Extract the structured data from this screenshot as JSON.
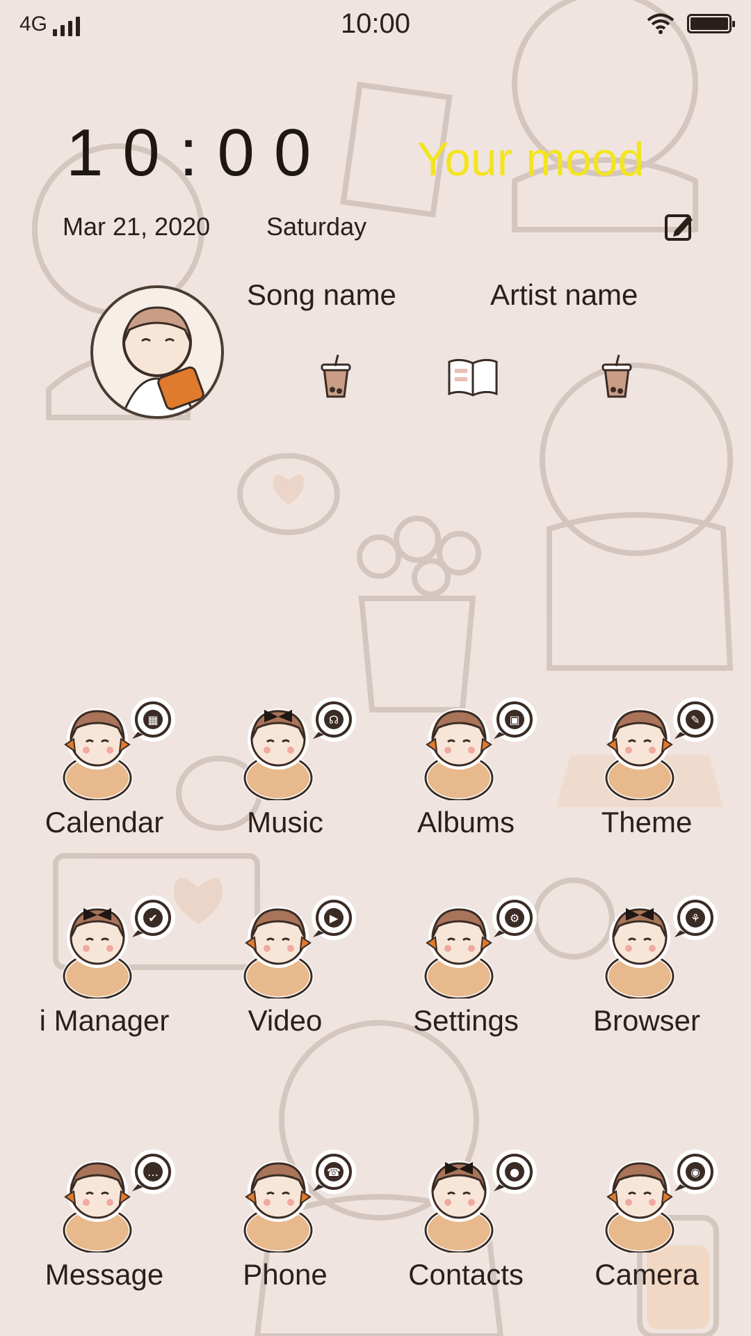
{
  "status_bar": {
    "network": "4G",
    "time": "10:00"
  },
  "widget": {
    "clock": "10:00",
    "mood": "Your mood",
    "date": "Mar 21, 2020",
    "weekday": "Saturday",
    "song": "Song name",
    "artist": "Artist name",
    "controls": [
      "previous-button",
      "playlist-button",
      "next-button"
    ]
  },
  "apps": [
    {
      "label": "Calendar",
      "badge": "calendar-icon"
    },
    {
      "label": "Music",
      "badge": "headphones-icon"
    },
    {
      "label": "Albums",
      "badge": "image-icon"
    },
    {
      "label": "Theme",
      "badge": "brush-icon"
    },
    {
      "label": "i Manager",
      "badge": "shield-check-icon"
    },
    {
      "label": "Video",
      "badge": "clapper-icon"
    },
    {
      "label": "Settings",
      "badge": "gear-icon"
    },
    {
      "label": "Browser",
      "badge": "plant-icon"
    },
    {
      "label": "Message",
      "badge": "chat-icon"
    },
    {
      "label": "Phone",
      "badge": "phone-icon"
    },
    {
      "label": "Contacts",
      "badge": "person-icon"
    },
    {
      "label": "Camera",
      "badge": "camera-icon"
    }
  ],
  "colors": {
    "background": "#efe4df",
    "mood": "#f3e51d",
    "text": "#2a201b",
    "accent": "#e07a2c"
  }
}
